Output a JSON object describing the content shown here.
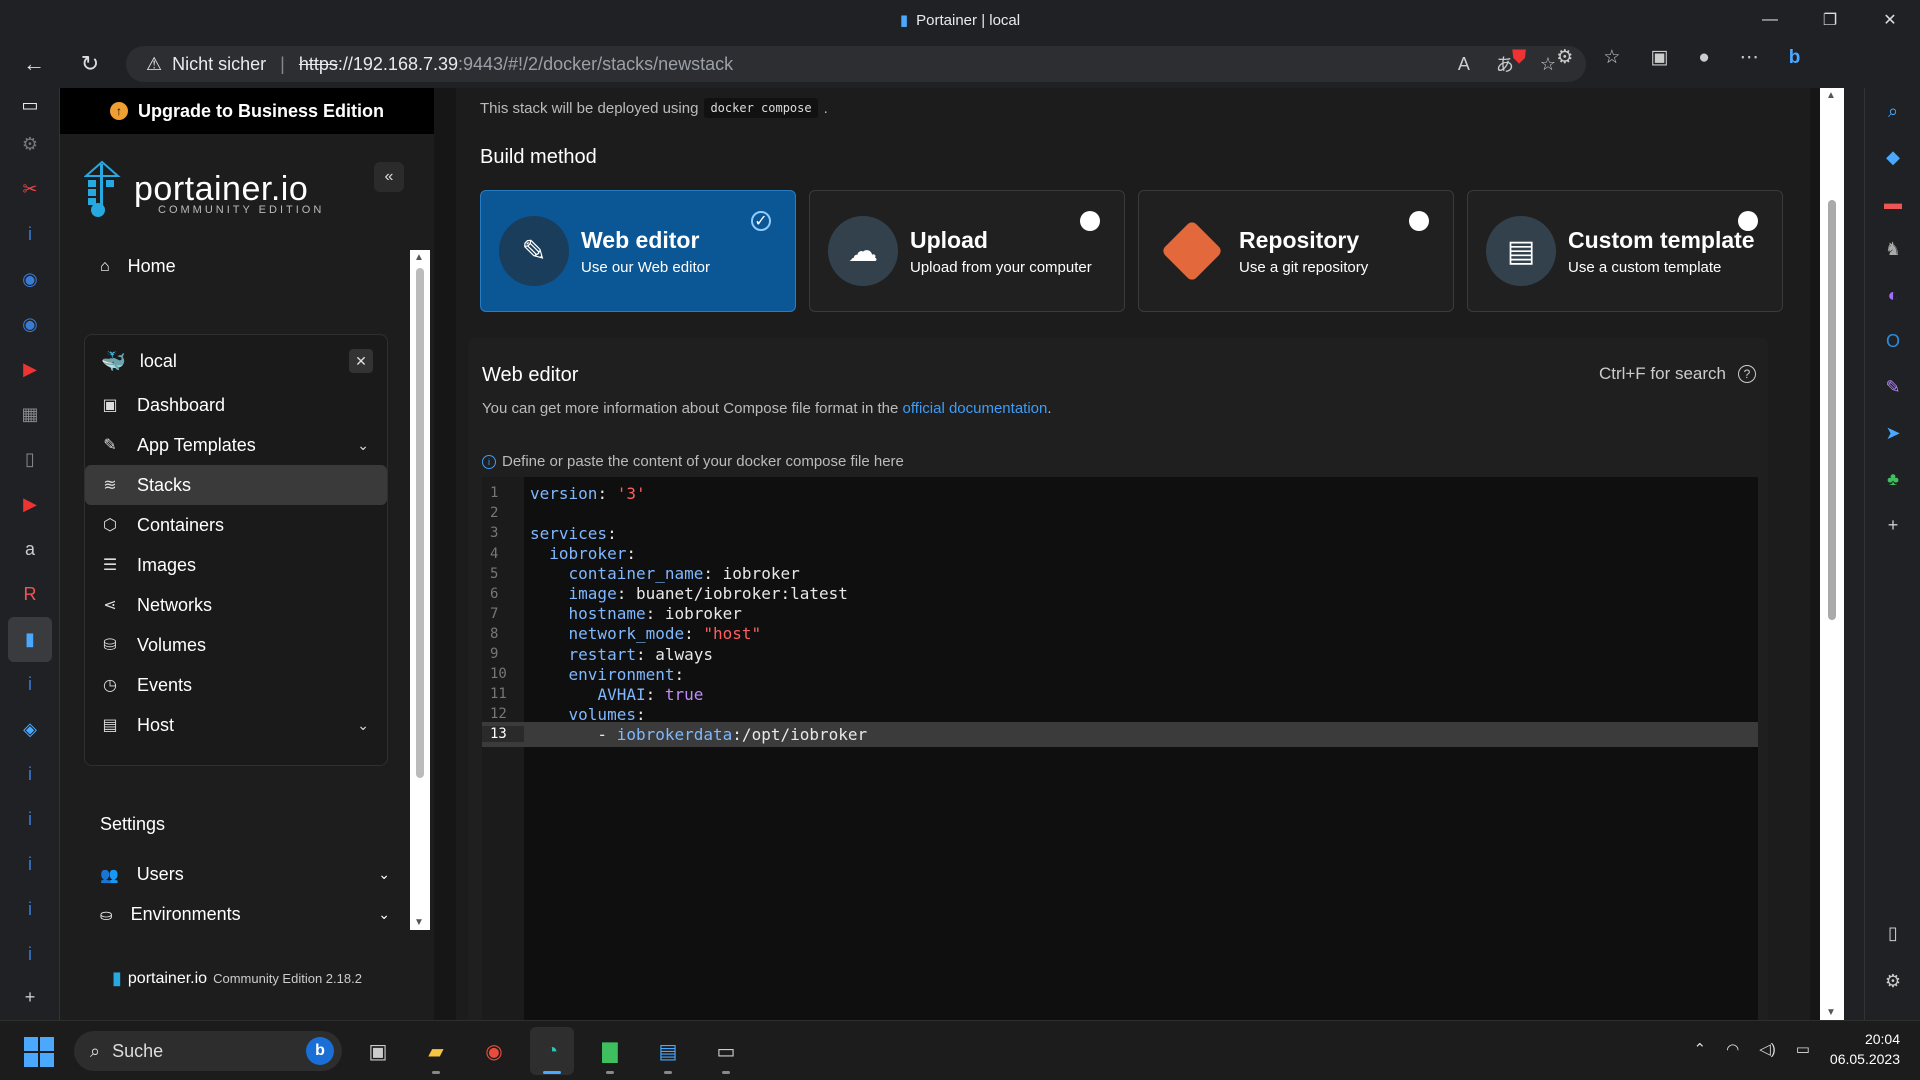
{
  "window": {
    "title": "Portainer | local"
  },
  "browser": {
    "security_label": "Nicht sicher",
    "url_protocol": "https",
    "url_host": "://192.168.7.39",
    "url_path": ":9443/#!/2/docker/stacks/newstack"
  },
  "sidebar": {
    "upgrade_label": "Upgrade to Business Edition",
    "logo_text": "portainer.io",
    "logo_sub": "COMMUNITY EDITION",
    "home_label": "Home",
    "environment": {
      "name": "local",
      "items": [
        {
          "label": "Dashboard",
          "icon": "dashboard-icon"
        },
        {
          "label": "App Templates",
          "icon": "edit-icon",
          "expandable": true
        },
        {
          "label": "Stacks",
          "icon": "layers-icon",
          "active": true
        },
        {
          "label": "Containers",
          "icon": "box-icon"
        },
        {
          "label": "Images",
          "icon": "list-icon"
        },
        {
          "label": "Networks",
          "icon": "share-icon"
        },
        {
          "label": "Volumes",
          "icon": "database-icon"
        },
        {
          "label": "Events",
          "icon": "clock-icon"
        },
        {
          "label": "Host",
          "icon": "server-icon",
          "expandable": true
        }
      ]
    },
    "settings_label": "Settings",
    "settings_items": [
      {
        "label": "Users"
      },
      {
        "label": "Environments"
      }
    ],
    "footer_name": "portainer.io",
    "footer_version": "Community Edition 2.18.2"
  },
  "main": {
    "deploy_note_prefix": "This stack will be deployed using",
    "deploy_note_code": "docker compose",
    "deploy_note_suffix": ".",
    "build_method_title": "Build method",
    "build_methods": [
      {
        "title": "Web editor",
        "subtitle": "Use our Web editor",
        "selected": true
      },
      {
        "title": "Upload",
        "subtitle": "Upload from your computer",
        "selected": false
      },
      {
        "title": "Repository",
        "subtitle": "Use a git repository",
        "selected": false
      },
      {
        "title": "Custom template",
        "subtitle": "Use a custom template",
        "selected": false
      }
    ],
    "editor": {
      "title": "Web editor",
      "search_hint": "Ctrl+F for search",
      "info_prefix": "You can get more information about Compose file format in the",
      "info_link": "official documentation",
      "info_suffix": ".",
      "hint": "Define or paste the content of your docker compose file here",
      "lines": [
        "version: '3'",
        "",
        "services:",
        "  iobroker:",
        "    container_name: iobroker",
        "    image: buanet/iobroker:latest",
        "    hostname: iobroker",
        "    network_mode: \"host\"",
        "    restart: always",
        "    environment:",
        "       AVHAI: true",
        "    volumes:",
        "       - iobrokerdata:/opt/iobroker"
      ],
      "active_line": 13
    }
  },
  "taskbar": {
    "search_label": "Suche",
    "time": "20:04",
    "date": "06.05.2023"
  },
  "colors": {
    "accent": "#0b5694",
    "link": "#3e9cf7",
    "string": "#ff5f5f",
    "key": "#7fb8ff",
    "git": "#e3683c"
  }
}
